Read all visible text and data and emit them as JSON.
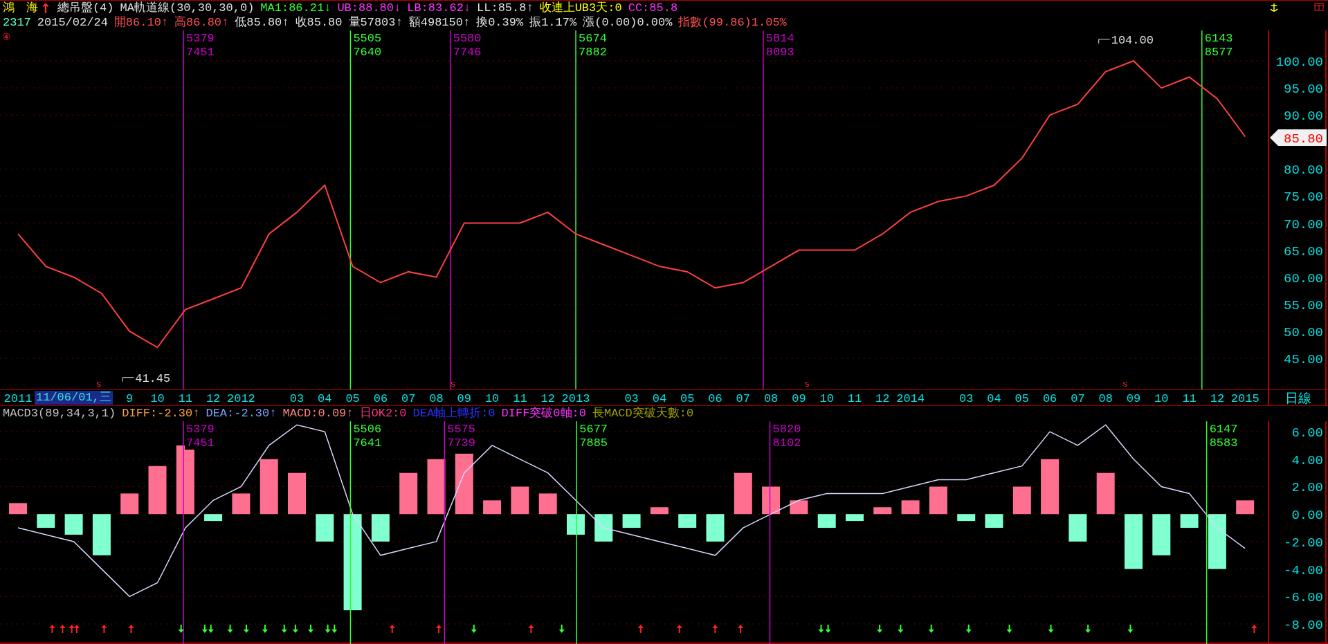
{
  "header": {
    "line_1": [
      {
        "text": "鴻　海",
        "color": "#ffff00"
      },
      {
        "text": "↑",
        "color": "#ff3030"
      },
      {
        "text": "總吊盤(4)",
        "color": "#e0e0e0"
      },
      {
        "text": "MA軌道線(30,30,30,0)",
        "color": "#e0e0e0"
      },
      {
        "text": "MA1:86.21↓",
        "color": "#33ff33"
      },
      {
        "text": "UB:88.80↓",
        "color": "#ff33ff"
      },
      {
        "text": "LB:83.62↓",
        "color": "#ff33ff"
      },
      {
        "text": "LL:85.8↑",
        "color": "#e0e0e0"
      },
      {
        "text": "收連上UB3天:0",
        "color": "#ffff00"
      },
      {
        "text": "CC:85.8",
        "color": "#ff33ff"
      }
    ],
    "line_2": [
      {
        "text": "2317",
        "color": "#66ffcc"
      },
      {
        "text": "2015/02/24",
        "color": "#e0e0e0"
      },
      {
        "text": "開86.10↑",
        "color": "#ff5050"
      },
      {
        "text": "高86.80↑",
        "color": "#ff5050"
      },
      {
        "text": "低85.80↑",
        "color": "#e0e0e0"
      },
      {
        "text": "收85.80",
        "color": "#e0e0e0"
      },
      {
        "text": "量57803↑",
        "color": "#e0e0e0"
      },
      {
        "text": "額498150↑",
        "color": "#e0e0e0"
      },
      {
        "text": "換0.39%",
        "color": "#e0e0e0"
      },
      {
        "text": "振1.17%",
        "color": "#e0e0e0"
      },
      {
        "text": "漲(0.00)0.00%",
        "color": "#e0e0e0"
      },
      {
        "text": "指數(99.86)1.05%",
        "color": "#ff5050"
      }
    ]
  },
  "price_panel": {
    "corner_mark": "④",
    "cursor_label": "11/06/01,三",
    "vlines": [
      {
        "color": "#cc00cc",
        "labels": [
          "5379",
          "7451"
        ]
      },
      {
        "color": "#33ff33",
        "labels": [
          "5505",
          "7640"
        ]
      },
      {
        "color": "#cc00cc",
        "labels": [
          "5580",
          "7746"
        ]
      },
      {
        "color": "#33ff33",
        "labels": [
          "5674",
          "7882"
        ]
      },
      {
        "color": "#cc00cc",
        "labels": [
          "5814",
          "8093"
        ]
      },
      {
        "color": "#33ff33",
        "labels": [
          "6143",
          "8577"
        ]
      }
    ],
    "dividend_marks": [
      "s",
      "s",
      "s",
      "s"
    ],
    "chart_data": {
      "type": "line",
      "categories": [
        "2011",
        null,
        null,
        null,
        "9",
        "10",
        "11",
        "12",
        "2012",
        null,
        "03",
        "04",
        "05",
        "06",
        "07",
        "08",
        "09",
        "10",
        "11",
        "12",
        "2013",
        null,
        "03",
        "04",
        "05",
        "06",
        "07",
        "08",
        "09",
        "10",
        "11",
        "12",
        "2014",
        null,
        "03",
        "04",
        "05",
        "06",
        "07",
        "08",
        "09",
        "10",
        "11",
        "12",
        "2015"
      ],
      "values": [
        68,
        62,
        60,
        57,
        50,
        47,
        54,
        56,
        58,
        68,
        72,
        77,
        62,
        59,
        61,
        60,
        70,
        70,
        70,
        72,
        68,
        66,
        64,
        62,
        61,
        58,
        59,
        62,
        65,
        65,
        65,
        68,
        72,
        74,
        75,
        77,
        82,
        90,
        92,
        98,
        100,
        95,
        97,
        93,
        86
      ],
      "ylim": [
        39.24,
        105.63
      ],
      "grid": true,
      "yticks": [
        {
          "value": 100,
          "label": "100.00"
        },
        {
          "value": 95,
          "label": "95.00"
        },
        {
          "value": 90,
          "label": "90.00"
        },
        {
          "value": 80,
          "label": "80.00"
        },
        {
          "value": 75,
          "label": "75.00"
        },
        {
          "value": 70,
          "label": "70.00"
        },
        {
          "value": 65,
          "label": "65.00"
        },
        {
          "value": 60,
          "label": "60.00"
        },
        {
          "value": 55,
          "label": "55.00"
        },
        {
          "value": 50,
          "label": "50.00"
        },
        {
          "value": 45,
          "label": "45.00"
        }
      ],
      "annotations": [
        "104.00",
        "41.45",
        "85.80"
      ]
    }
  },
  "period_label": "日線",
  "macd_panel": {
    "header": [
      {
        "text": "MACD3(89,34,3,1)",
        "color": "#c0c0c0"
      },
      {
        "text": "DIFF:-2.30↑",
        "color": "#ffa040"
      },
      {
        "text": "DEA:-2.30↑",
        "color": "#80a0ff"
      },
      {
        "text": "MACD:0.09↑",
        "color": "#ff8080"
      },
      {
        "text": "日OK2:0",
        "color": "#ff3080"
      },
      {
        "text": "DEA軸上轉折:0",
        "color": "#3030ff"
      },
      {
        "text": "DIFF突破0軸:0",
        "color": "#ff33ff"
      },
      {
        "text": "長MACD突破天數:0",
        "color": "#a0a000"
      }
    ],
    "vlines": [
      {
        "color": "#cc00cc",
        "labels": [
          "5379",
          "7451"
        ]
      },
      {
        "color": "#33ff33",
        "labels": [
          "5506",
          "7641"
        ]
      },
      {
        "color": "#cc00cc",
        "labels": [
          "5575",
          "7739"
        ]
      },
      {
        "color": "#33ff33",
        "labels": [
          "5677",
          "7885"
        ]
      },
      {
        "color": "#cc00cc",
        "labels": [
          "5820",
          "8102"
        ]
      },
      {
        "color": "#33ff33",
        "labels": [
          "6147",
          "8583"
        ]
      }
    ],
    "signals": [
      {
        "kind": "up"
      },
      {
        "kind": "up"
      },
      {
        "kind": "up"
      },
      {
        "kind": "up"
      },
      {
        "kind": "up"
      },
      {
        "kind": "up"
      },
      {
        "kind": "down"
      },
      {
        "kind": "down"
      },
      {
        "kind": "down"
      },
      {
        "kind": "down"
      },
      {
        "kind": "down"
      },
      {
        "kind": "down"
      },
      {
        "kind": "down"
      },
      {
        "kind": "down"
      },
      {
        "kind": "down"
      },
      {
        "kind": "down"
      },
      {
        "kind": "down"
      },
      {
        "kind": "up"
      },
      {
        "kind": "up"
      },
      {
        "kind": "down"
      },
      {
        "kind": "up"
      },
      {
        "kind": "down"
      },
      {
        "kind": "up"
      },
      {
        "kind": "up"
      },
      {
        "kind": "up"
      },
      {
        "kind": "up"
      },
      {
        "kind": "down"
      },
      {
        "kind": "down"
      },
      {
        "kind": "down"
      },
      {
        "kind": "down"
      },
      {
        "kind": "down"
      },
      {
        "kind": "down"
      },
      {
        "kind": "down"
      },
      {
        "kind": "down"
      },
      {
        "kind": "down"
      },
      {
        "kind": "down"
      },
      {
        "kind": "up"
      }
    ],
    "chart_data": {
      "type": "bar",
      "series": [
        {
          "color": "#ff7090",
          "values": [
            0.8,
            null,
            null,
            null,
            1.5,
            3.5,
            5,
            null,
            1.5,
            4,
            3,
            null,
            null,
            null,
            3,
            4,
            4.4,
            1,
            2,
            1.5,
            null,
            null,
            null,
            0.5,
            null,
            null,
            3,
            2,
            1,
            null,
            null,
            0.5,
            1,
            2,
            null,
            null,
            2,
            4,
            null,
            3,
            null,
            null,
            null,
            null,
            1
          ]
        },
        {
          "color": "#80ffd0",
          "values": [
            null,
            -1,
            -1.5,
            -3,
            null,
            null,
            null,
            -0.5,
            null,
            null,
            null,
            -2,
            -7,
            -2,
            null,
            null,
            null,
            null,
            null,
            null,
            -1.5,
            -2,
            -1,
            null,
            -1,
            -2,
            null,
            null,
            null,
            -1,
            -0.5,
            null,
            null,
            null,
            -0.5,
            -1,
            null,
            null,
            -2,
            null,
            -4,
            -3,
            -1,
            -4,
            null
          ]
        },
        {
          "type": "line",
          "color": "#d8d8ff",
          "values": [
            -1,
            -1.5,
            -2,
            -4,
            -6,
            -5,
            -1,
            1,
            2,
            5,
            6.5,
            6,
            0,
            -3,
            -2.5,
            -2,
            3,
            5,
            4,
            3,
            1,
            -1,
            -1.5,
            -2,
            -2.5,
            -3,
            -1,
            0,
            1,
            1.5,
            1.5,
            1.5,
            2,
            2.5,
            2.5,
            3,
            3.5,
            6,
            5,
            6.5,
            4,
            2,
            1.5,
            -1,
            -2.5
          ]
        }
      ],
      "ylim": [
        -9.46,
        6.76
      ],
      "grid": true,
      "yticks": [
        {
          "value": 6,
          "label": "6.00"
        },
        {
          "value": 4,
          "label": "4.00"
        },
        {
          "value": 2,
          "label": "2.00"
        },
        {
          "value": 0,
          "label": "0.00"
        },
        {
          "value": -2,
          "label": "-2.00"
        },
        {
          "value": -4,
          "label": "-4.00"
        },
        {
          "value": -6,
          "label": "-6.00"
        },
        {
          "value": -8,
          "label": "-8.00"
        }
      ]
    }
  }
}
